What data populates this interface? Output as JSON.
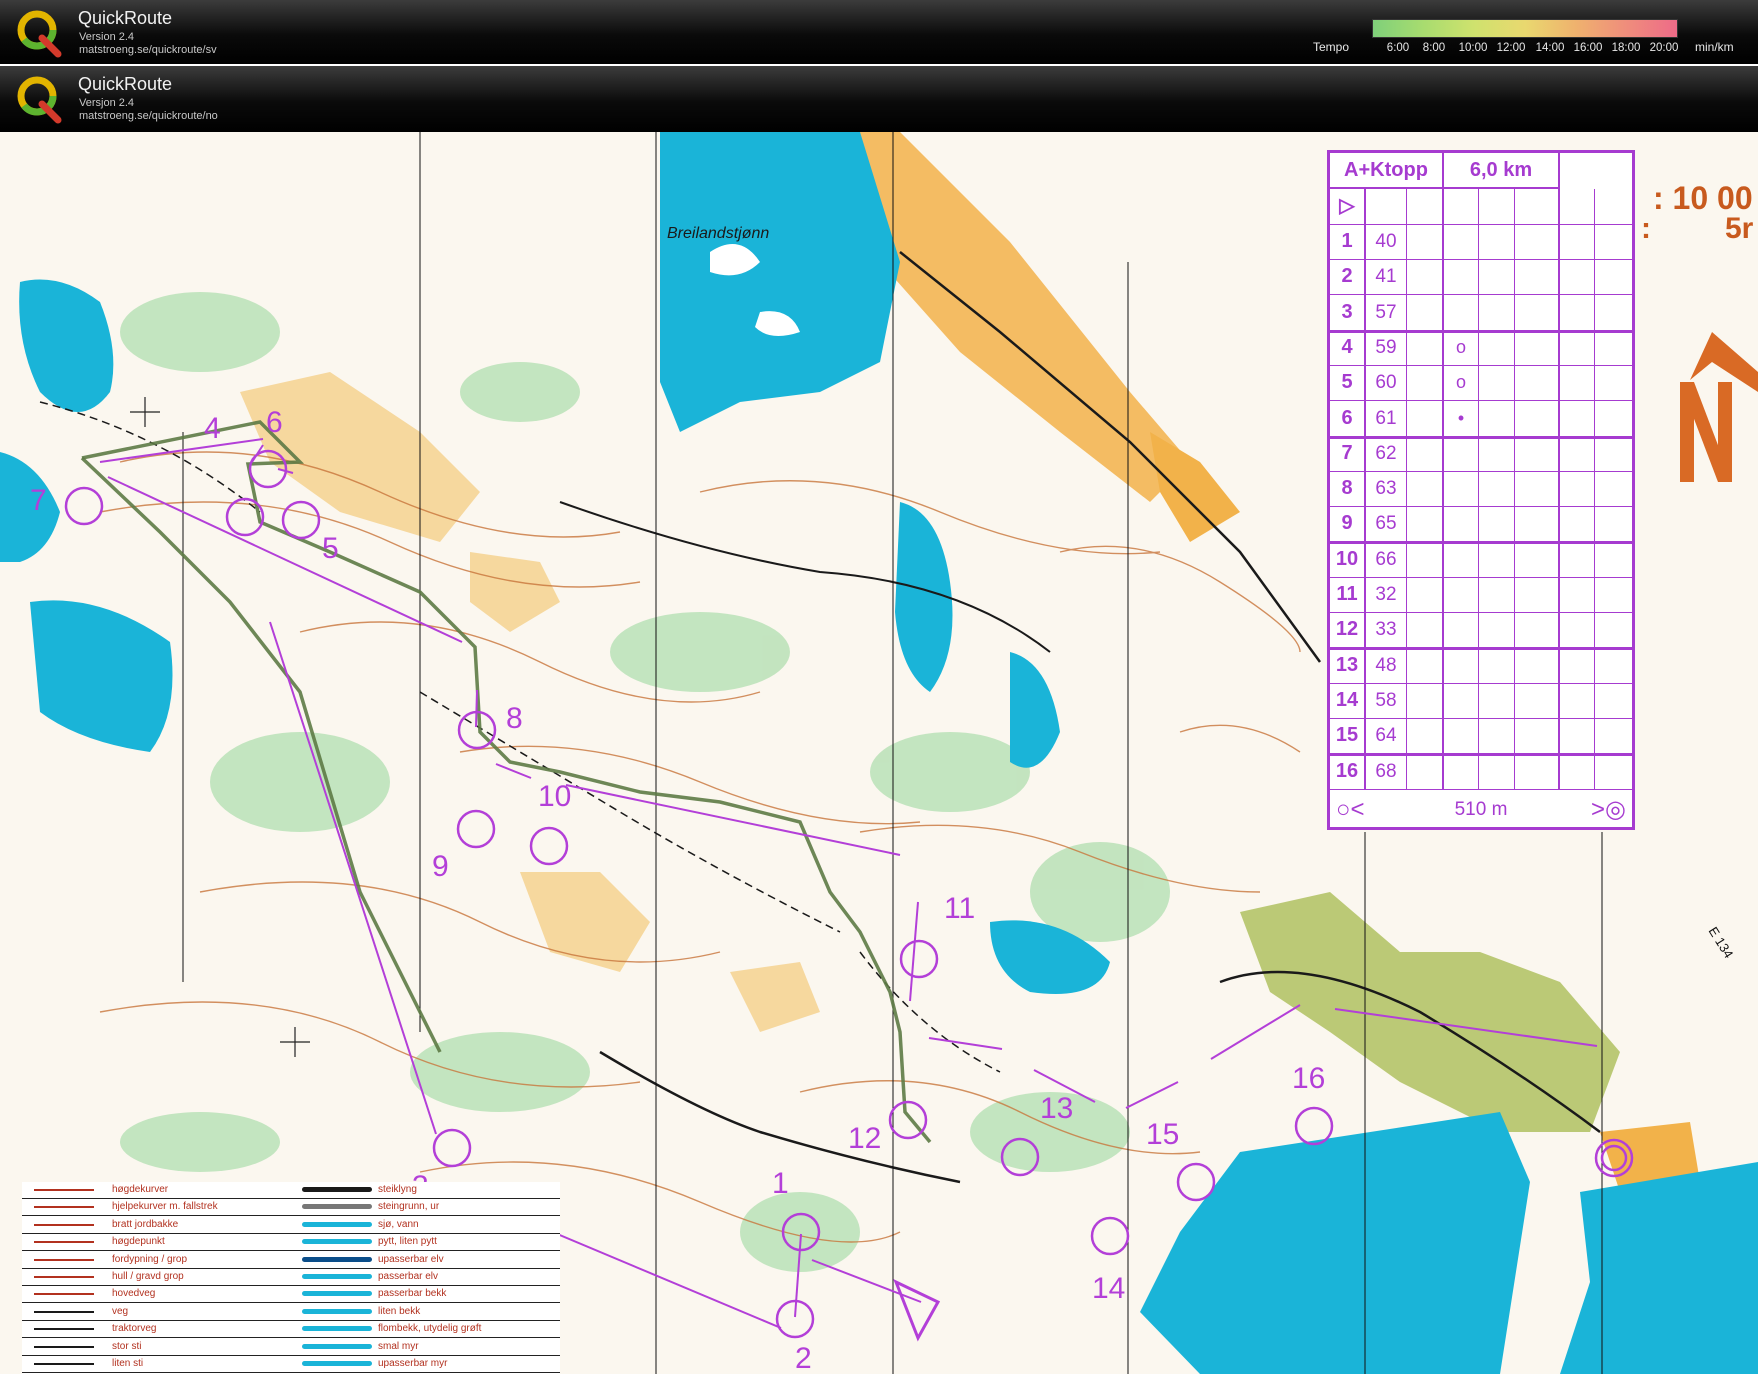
{
  "app": {
    "banner1": {
      "title": "QuickRoute",
      "version": "Version 2.4",
      "url": "matstroeng.se/quickroute/sv"
    },
    "banner2": {
      "title": "QuickRoute",
      "version": "Versjon 2.4",
      "url": "matstroeng.se/quickroute/no"
    },
    "tempo": {
      "label": "Tempo",
      "ticks": [
        "6:00",
        "8:00",
        "10:00",
        "12:00",
        "14:00",
        "16:00",
        "18:00",
        "20:00"
      ],
      "unit": "min/km"
    }
  },
  "map": {
    "lake_name": "Breilandstjønn",
    "road_label": "E 134",
    "top_right_text": {
      "time": ": 10 00",
      "scale_fragment": "5r",
      "colon": ":"
    },
    "control_labels": [
      "1",
      "2",
      "3",
      "4",
      "5",
      "6",
      "7",
      "8",
      "9",
      "10",
      "11",
      "12",
      "13",
      "14",
      "15",
      "16"
    ]
  },
  "control_description": {
    "course": "A+Ktopp",
    "length": "6,0 km",
    "rows": [
      {
        "num": "1",
        "code": "40",
        "symbol": ""
      },
      {
        "num": "2",
        "code": "41",
        "symbol": ""
      },
      {
        "num": "3",
        "code": "57",
        "symbol": ""
      },
      {
        "num": "4",
        "code": "59",
        "symbol": "o"
      },
      {
        "num": "5",
        "code": "60",
        "symbol": "o"
      },
      {
        "num": "6",
        "code": "61",
        "symbol": "•"
      },
      {
        "num": "7",
        "code": "62",
        "symbol": ""
      },
      {
        "num": "8",
        "code": "63",
        "symbol": ""
      },
      {
        "num": "9",
        "code": "65",
        "symbol": ""
      },
      {
        "num": "10",
        "code": "66",
        "symbol": ""
      },
      {
        "num": "11",
        "code": "32",
        "symbol": ""
      },
      {
        "num": "12",
        "code": "33",
        "symbol": ""
      },
      {
        "num": "13",
        "code": "48",
        "symbol": ""
      },
      {
        "num": "14",
        "code": "58",
        "symbol": ""
      },
      {
        "num": "15",
        "code": "64",
        "symbol": ""
      },
      {
        "num": "16",
        "code": "68",
        "symbol": ""
      }
    ],
    "finish": "510 m"
  },
  "legend": {
    "rows": [
      {
        "left": "høgdekurver",
        "right": "steiklyng"
      },
      {
        "left": "hjelpekurver m. fallstrek",
        "right": "steingrunn, ur"
      },
      {
        "left": "bratt jordbakke",
        "right": "sjø, vann"
      },
      {
        "left": "høgdepunkt",
        "right": "pytt, liten pytt"
      },
      {
        "left": "fordypning / grop",
        "right": "upasserbar elv"
      },
      {
        "left": "hull / gravd grop",
        "right": "passerbar elv"
      },
      {
        "left": "hovedveg",
        "right": "passerbar bekk"
      },
      {
        "left": "veg",
        "right": "liten bekk"
      },
      {
        "left": "traktorveg",
        "right": "flombekk, utydelig grøft"
      },
      {
        "left": "stor sti",
        "right": "smal myr"
      },
      {
        "left": "liten sti",
        "right": "upasserbar myr"
      }
    ]
  },
  "colors": {
    "course": "#b33fd8",
    "water": "#1ab4d8",
    "open": "#f5c06a",
    "contour": "#c8753b",
    "route": "#5d7a45"
  }
}
